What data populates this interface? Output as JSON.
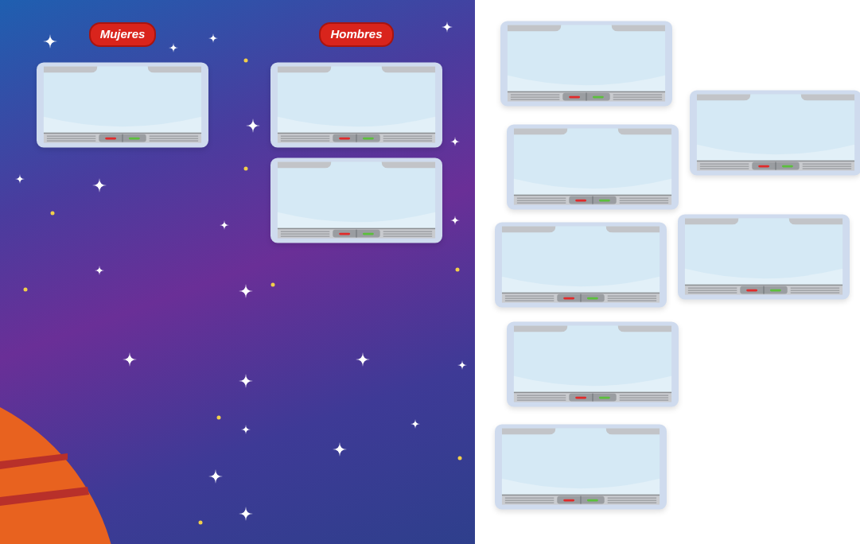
{
  "columns": [
    {
      "label": "Mujeres",
      "cards": [
        {
          "kind": "frame"
        }
      ]
    },
    {
      "label": "Hombres",
      "cards": [
        {
          "kind": "frame"
        },
        {
          "kind": "frame"
        }
      ]
    }
  ],
  "tray_cards": [
    {
      "kind": "frame"
    },
    {
      "kind": "frame"
    },
    {
      "kind": "frame"
    },
    {
      "kind": "frame"
    },
    {
      "kind": "frame"
    },
    {
      "kind": "frame"
    },
    {
      "kind": "frame"
    }
  ]
}
